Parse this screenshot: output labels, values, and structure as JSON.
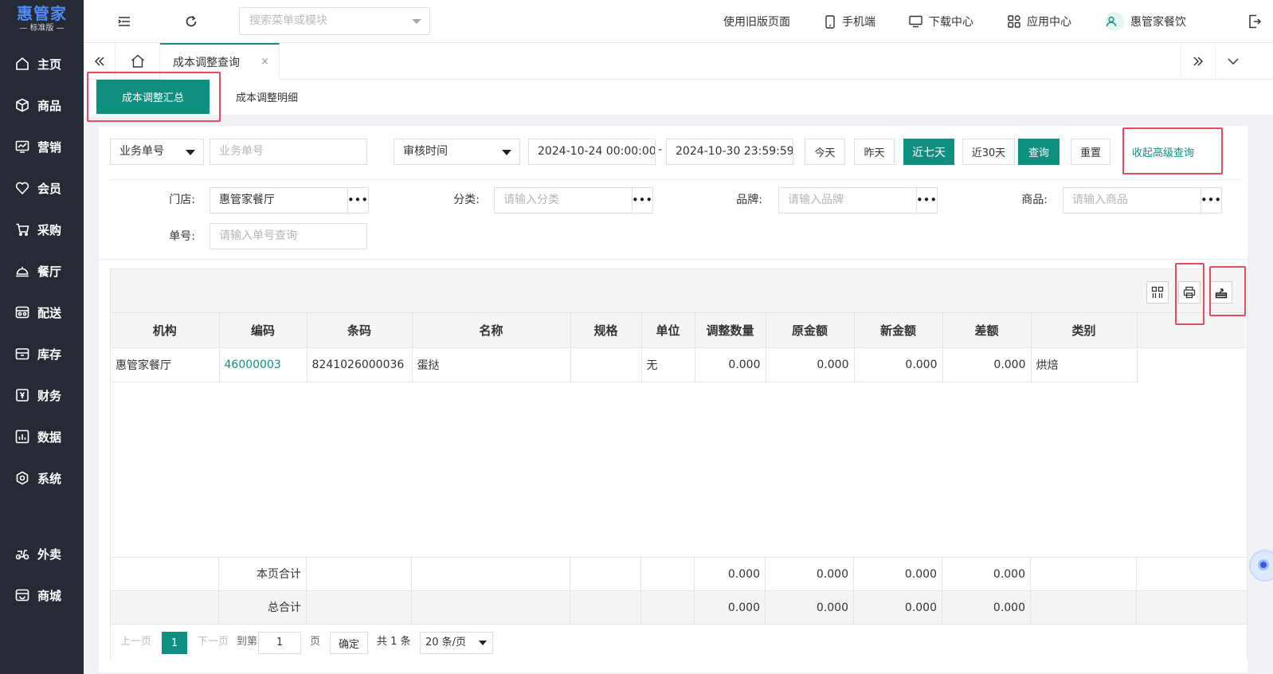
{
  "app": {
    "logo_name": "惠管家",
    "logo_sub": "— 标准版 —"
  },
  "sidebar": {
    "items": [
      {
        "label": "主页",
        "icon": "home-icon"
      },
      {
        "label": "商品",
        "icon": "cube-icon"
      },
      {
        "label": "营销",
        "icon": "chart-icon"
      },
      {
        "label": "会员",
        "icon": "heart-icon"
      },
      {
        "label": "采购",
        "icon": "cart-icon"
      },
      {
        "label": "餐厅",
        "icon": "bell-icon"
      },
      {
        "label": "配送",
        "icon": "truck-icon"
      },
      {
        "label": "库存",
        "icon": "box-icon"
      },
      {
        "label": "财务",
        "icon": "yen-icon"
      },
      {
        "label": "数据",
        "icon": "bar-chart-icon"
      },
      {
        "label": "系统",
        "icon": "gear-icon"
      },
      {
        "label": "外卖",
        "icon": "scooter-icon"
      },
      {
        "label": "商城",
        "icon": "shop-icon"
      }
    ]
  },
  "topbar": {
    "search_placeholder": "搜索菜单或模块",
    "old_page": "使用旧版页面",
    "mobile": "手机端",
    "download": "下载中心",
    "apps": "应用中心",
    "user": "惠管家餐饮"
  },
  "tabs": {
    "active": "成本调整查询",
    "close": "×"
  },
  "subtabs": {
    "summary": "成本调整汇总",
    "detail": "成本调整明细"
  },
  "filters": {
    "bill_type": "业务单号",
    "bill_placeholder": "业务单号",
    "time_type": "审核时间",
    "date_start": "2024-10-24 00:00:00",
    "date_sep": "-",
    "date_end": "2024-10-30 23:59:59",
    "today": "今天",
    "yesterday": "昨天",
    "last7": "近七天",
    "last30": "近30天",
    "query": "查询",
    "reset": "重置",
    "collapse": "收起高级查询",
    "store_label": "门店:",
    "store_value": "惠管家餐厅",
    "category_label": "分类:",
    "category_placeholder": "请输入分类",
    "brand_label": "品牌:",
    "brand_placeholder": "请输入品牌",
    "product_label": "商品:",
    "product_placeholder": "请输入商品",
    "no_label": "单号:",
    "no_placeholder": "请输入单号查询",
    "more": "•••"
  },
  "table": {
    "columns": [
      "机构",
      "编码",
      "条码",
      "名称",
      "规格",
      "单位",
      "调整数量",
      "原金额",
      "新金额",
      "差额",
      "类别"
    ],
    "rows": [
      {
        "org": "惠管家餐厅",
        "code": "46000003",
        "barcode": "8241026000036",
        "name": "蛋挞",
        "spec": "",
        "unit": "无",
        "qty": "0.000",
        "old_amount": "0.000",
        "new_amount": "0.000",
        "diff": "0.000",
        "category": "烘焙"
      }
    ],
    "page_total": {
      "label": "本页合计",
      "qty": "0.000",
      "old_amount": "0.000",
      "new_amount": "0.000",
      "diff": "0.000"
    },
    "grand_total": {
      "label": "总合计",
      "qty": "0.000",
      "old_amount": "0.000",
      "new_amount": "0.000",
      "diff": "0.000"
    }
  },
  "pager": {
    "prev": "上一页",
    "current": "1",
    "next": "下一页",
    "goto": "到第",
    "page_input": "1",
    "page_unit": "页",
    "confirm": "确定",
    "total": "共 1 条",
    "page_size": "20 条/页"
  },
  "colors": {
    "accent": "#0e8f80",
    "sidebar": "#262a35",
    "highlight_box": "#e84a5f"
  }
}
